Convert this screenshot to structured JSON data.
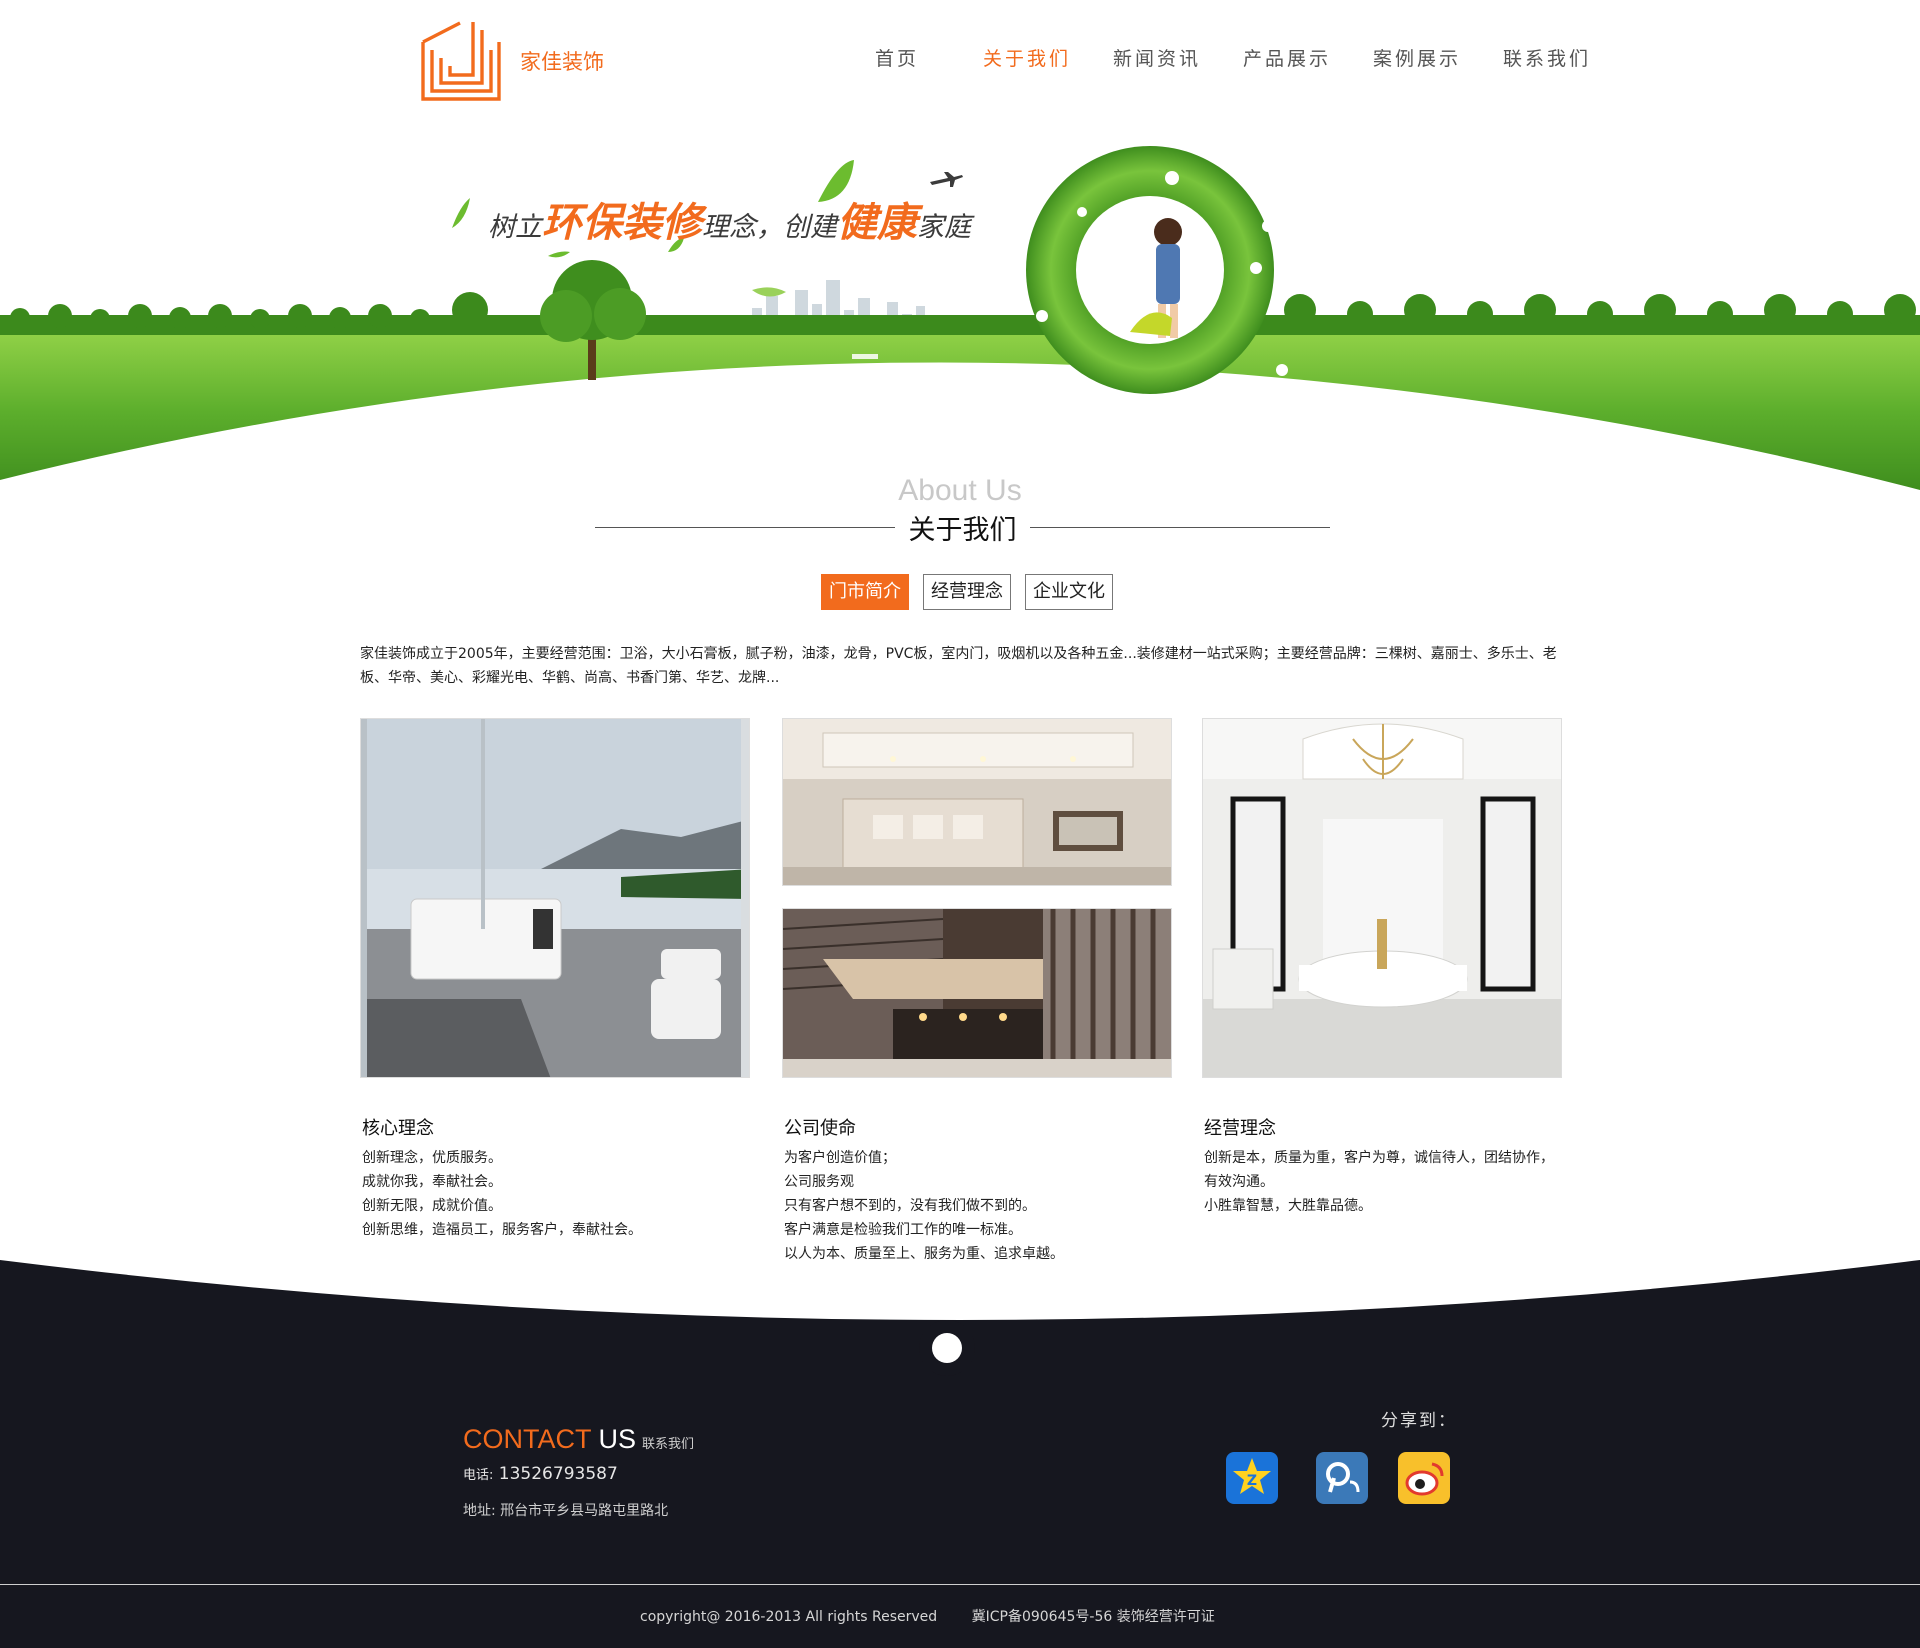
{
  "header": {
    "logo_text": "家佳装饰",
    "nav": [
      {
        "label": "首页",
        "active": false
      },
      {
        "label": "关于我们",
        "active": true
      },
      {
        "label": "新闻资讯",
        "active": false
      },
      {
        "label": "产品展示",
        "active": false
      },
      {
        "label": "案例展示",
        "active": false
      },
      {
        "label": "联系我们",
        "active": false
      }
    ]
  },
  "banner": {
    "slogan_1": "树立",
    "slogan_2": "环保装修",
    "slogan_3": "理念，",
    "slogan_4": "创建",
    "slogan_5": "健康",
    "slogan_6": "家庭"
  },
  "about": {
    "title_en": "About Us",
    "title_cn": "关于我们",
    "tabs": [
      {
        "label": "门市简介",
        "active": true
      },
      {
        "label": "经营理念",
        "active": false
      },
      {
        "label": "企业文化",
        "active": false
      }
    ],
    "intro": "家佳装饰成立于2005年，主要经营范围：卫浴，大小石膏板，腻子粉，油漆，龙骨，PVC板，室内门，吸烟机以及各种五金...装修建材一站式采购；主要经营品牌：三棵树、嘉丽士、多乐士、老板、华帝、美心、彩耀光电、华鹤、尚高、书香门第、华艺、龙牌..."
  },
  "columns": [
    {
      "title": "核心理念",
      "lines": [
        "创新理念，优质服务。",
        "成就你我，奉献社会。",
        "创新无限，成就价值。",
        "创新思维，造福员工，服务客户，奉献社会。"
      ]
    },
    {
      "title": "公司使命",
      "lines": [
        "为客户创造价值；",
        "公司服务观",
        "只有客户想不到的，没有我们做不到的。",
        "客户满意是检验我们工作的唯一标准。",
        "以人为本、质量至上、服务为重、追求卓越。"
      ]
    },
    {
      "title": "经营理念",
      "lines": [
        "创新是本，质量为重，客户为尊，诚信待人，团结协作，有效沟通。",
        "小胜靠智慧，大胜靠品德。"
      ]
    }
  ],
  "footer": {
    "contact_1": "CONTACT",
    "contact_2": " US",
    "contact_cn": "联系我们",
    "phone_label": "电话:",
    "phone": "13526793587",
    "address": "地址: 邢台市平乡县马路屯里路北",
    "share_label": "分享到：",
    "share_icons": [
      "qzone-icon",
      "tencent-weibo-icon",
      "sina-weibo-icon"
    ],
    "copyright": "copyright@ 2016-2013    All rights Reserved",
    "icp": "冀ICP备090645号-56 装饰经营许可证"
  },
  "colors": {
    "accent": "#f26b1d",
    "footer_bg": "#16171f",
    "grass": "#5fb32e"
  }
}
